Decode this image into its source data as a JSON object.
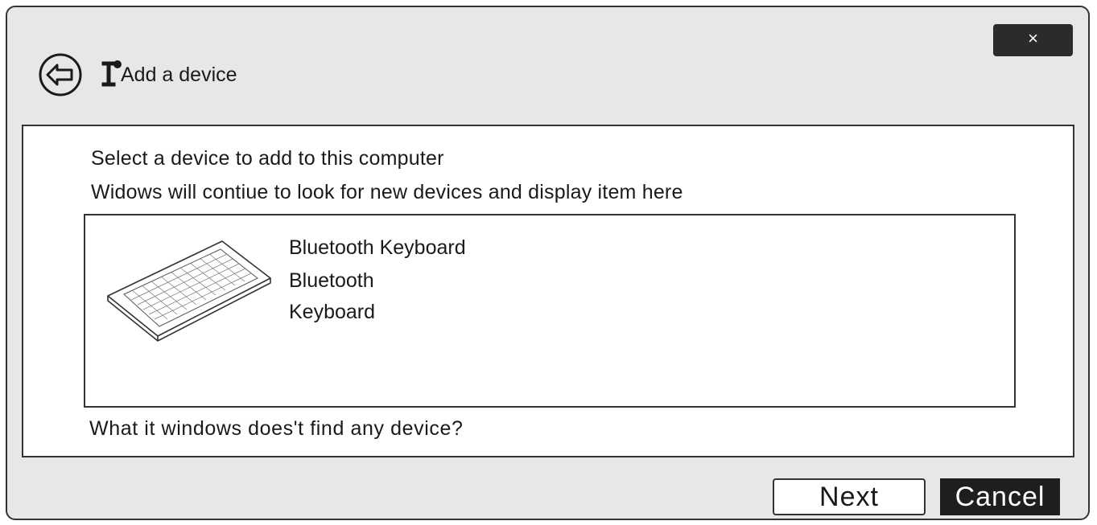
{
  "window": {
    "close_label": "×",
    "title": "Add a device"
  },
  "content": {
    "instruction_line1": "Select a device to add to this computer",
    "instruction_line2": "Widows will contiue to look for new devices and display item here",
    "devices": [
      {
        "name": "Bluetooth Keyboard",
        "type": "Bluetooth",
        "category": "Keyboard",
        "icon": "keyboard-icon"
      }
    ],
    "help_link": "What it windows does't find any device?"
  },
  "buttons": {
    "next_label": "Next",
    "cancel_label": "Cancel"
  },
  "colors": {
    "window_bg": "#e6e7e8",
    "dark_button": "#1e1e1e"
  }
}
